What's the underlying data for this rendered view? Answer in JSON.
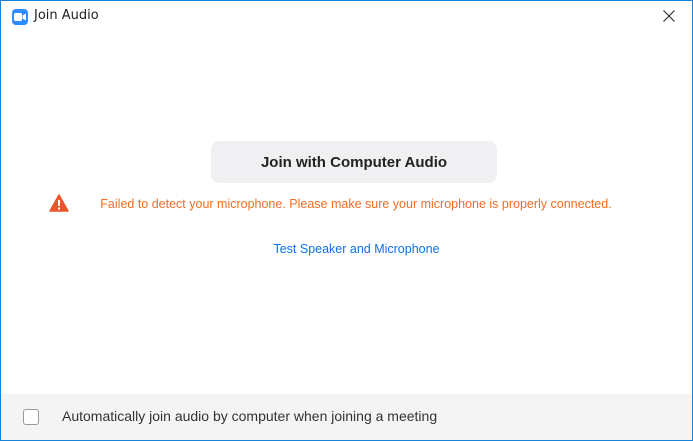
{
  "window": {
    "title": "Join Audio",
    "app_icon": "zoom-camera-icon",
    "close_icon": "close-icon"
  },
  "main": {
    "join_button_label": "Join with Computer Audio",
    "error_icon": "warning-triangle-icon",
    "error_message": "Failed to detect your microphone. Please make sure your microphone is properly connected.",
    "test_link_label": "Test Speaker and Microphone"
  },
  "footer": {
    "auto_join_checked": false,
    "auto_join_label": "Automatically join audio by computer when joining a meeting"
  },
  "colors": {
    "accent": "#2d8cff",
    "error": "#f26d21",
    "link": "#0e71eb",
    "warning_icon": "#e8572a"
  }
}
